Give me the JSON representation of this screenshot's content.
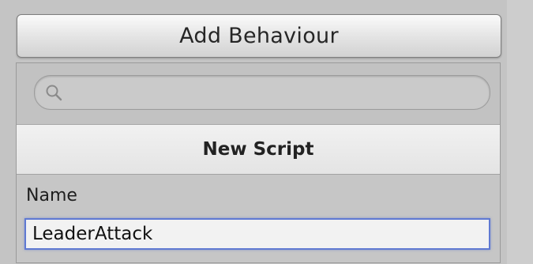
{
  "add_behaviour": {
    "label": "Add Behaviour"
  },
  "search": {
    "value": "",
    "placeholder": "",
    "icon": "search-icon"
  },
  "new_script": {
    "title": "New Script",
    "name_label": "Name",
    "name_value": "LeaderAttack"
  }
}
